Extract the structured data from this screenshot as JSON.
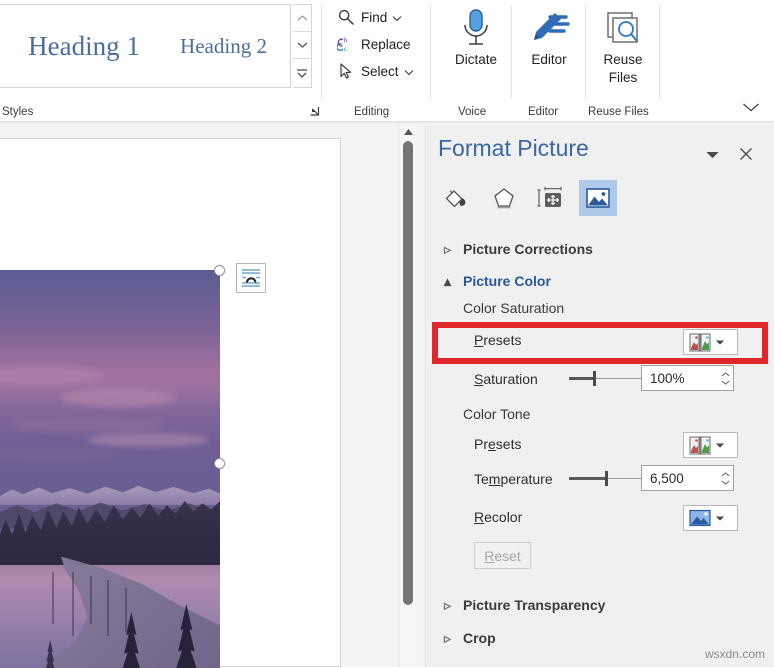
{
  "ribbon": {
    "styles_group": {
      "label": "Styles",
      "dialog_launcher": "dialog-launcher-icon",
      "gallery_items": [
        {
          "label": "Heading 1"
        },
        {
          "label": "Heading 2"
        }
      ],
      "scroll_up": "chevron-up-icon",
      "scroll_down": "chevron-down-icon",
      "more": "more-styles-icon"
    },
    "editing_group": {
      "label": "Editing",
      "items": [
        {
          "label": "Find",
          "icon": "search-icon",
          "has_dropdown": true
        },
        {
          "label": "Replace",
          "icon": "replace-icon",
          "has_dropdown": false
        },
        {
          "label": "Select",
          "icon": "cursor-arrow-icon",
          "has_dropdown": true
        }
      ]
    },
    "voice_group": {
      "label": "Voice",
      "button": {
        "label": "Dictate",
        "icon": "microphone-icon"
      }
    },
    "editor_group": {
      "label": "Editor",
      "button": {
        "label": "Editor",
        "icon": "editor-pen-icon"
      }
    },
    "reuse_group": {
      "label": "Reuse Files",
      "button": {
        "label_line1": "Reuse",
        "label_line2": "Files",
        "icon": "reuse-files-icon"
      }
    },
    "collapse_ribbon": "chevron-down-icon"
  },
  "document": {
    "picture": {
      "alt": "purple dusk landscape photo of lake and forest",
      "selected": true,
      "layout_options_icon": "layout-options-icon"
    },
    "scrollbar": {
      "up_arrow": "triangle-up-icon"
    }
  },
  "pane": {
    "title": "Format Picture",
    "menu_icon": "chevron-down-icon",
    "close_icon": "close-icon",
    "tabs": [
      {
        "name": "fill-and-line",
        "icon": "paint-bucket-icon",
        "selected": false
      },
      {
        "name": "effects",
        "icon": "pentagon-icon",
        "selected": false
      },
      {
        "name": "layout-and-properties",
        "icon": "size-properties-icon",
        "selected": false
      },
      {
        "name": "picture",
        "icon": "picture-icon",
        "selected": true
      }
    ],
    "sections": {
      "picture_corrections": {
        "label": "Picture Corrections",
        "expanded": false,
        "tri": "▹"
      },
      "picture_color": {
        "label": "Picture Color",
        "expanded": true,
        "tri": "▴"
      },
      "picture_transparency": {
        "label": "Picture Transparency",
        "expanded": false,
        "tri": "▹"
      },
      "crop": {
        "label": "Crop",
        "expanded": false,
        "tri": "▹"
      }
    },
    "color_saturation": {
      "group_label": "Color Saturation",
      "presets_label_pre": "P",
      "presets_label_post": "resets",
      "presets_icon": "saturation-presets-icon",
      "presets_dropdown": "chevron-down-icon",
      "saturation_label_pre": "S",
      "saturation_label_post": "aturation",
      "saturation_value": "100%",
      "saturation_slider_percent": 33
    },
    "color_tone": {
      "group_label": "Color Tone",
      "presets_label_pre": "Pr",
      "presets_label_mid": "e",
      "presets_label_post": "sets",
      "presets_icon": "tone-presets-icon",
      "presets_dropdown": "chevron-down-icon",
      "temperature_label_pre": "Te",
      "temperature_label_mid": "m",
      "temperature_label_post": "perature",
      "temperature_value": "6,500",
      "temperature_slider_percent": 50,
      "recolor_label_pre": "R",
      "recolor_label_post": "ecolor",
      "recolor_icon": "recolor-picture-icon",
      "recolor_dropdown": "chevron-down-icon"
    },
    "reset_button": {
      "label_pre": "R",
      "label_post": "eset",
      "enabled": false
    },
    "highlight_color": "#E0272C"
  },
  "watermark": "wsxdn.com"
}
